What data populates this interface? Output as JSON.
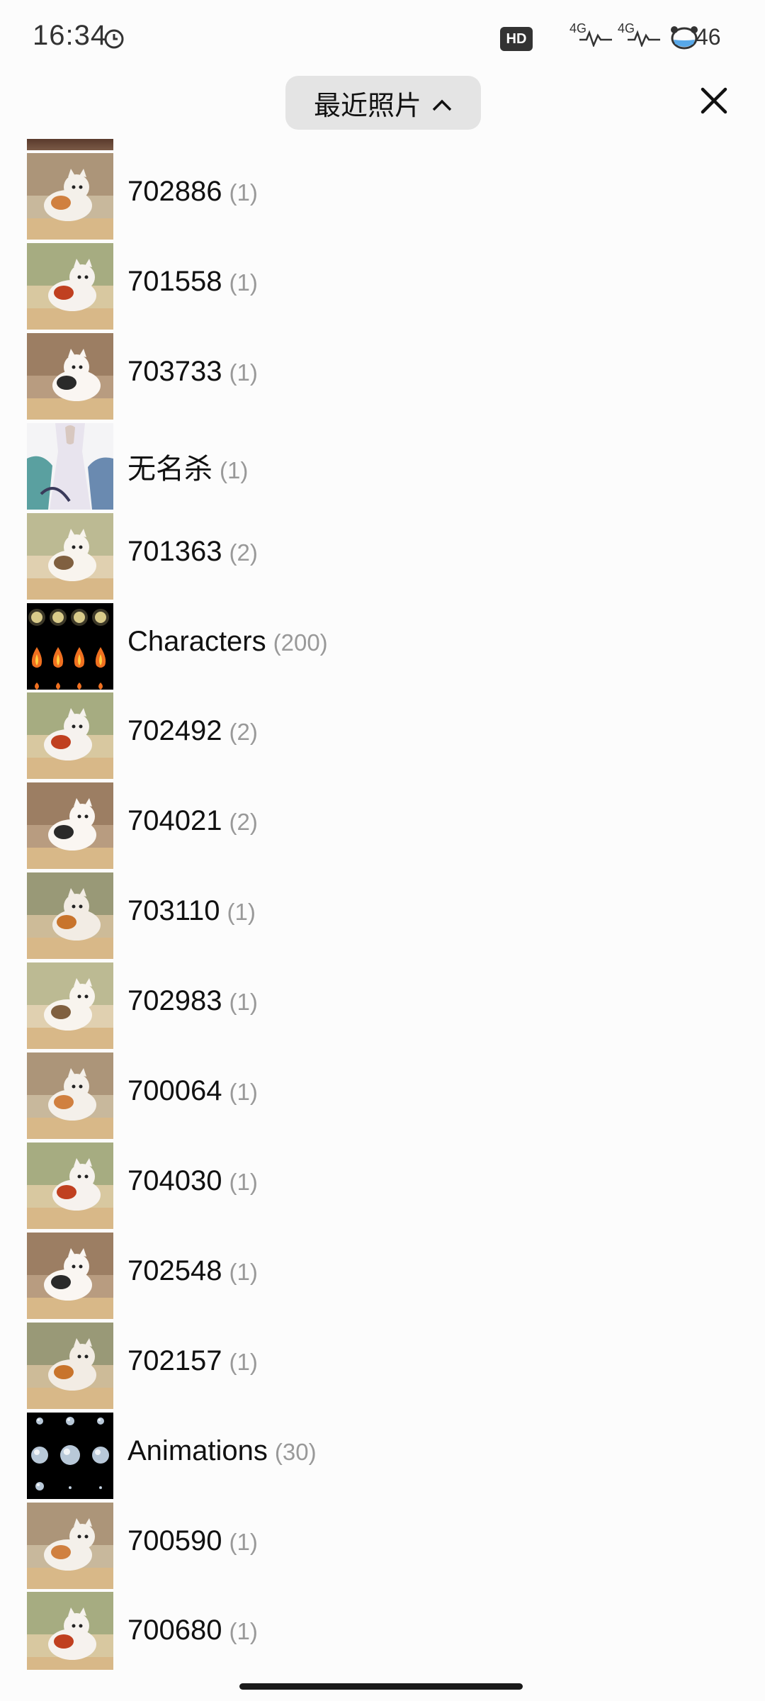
{
  "status_bar": {
    "time": "16:34",
    "hd_label": "HD",
    "net1": "4G",
    "net2": "4G",
    "battery": "46"
  },
  "header": {
    "album_picker_label": "最近照片",
    "close_icon": "close-icon",
    "chevron_icon": "chevron-up-icon"
  },
  "albums": [
    {
      "name": "702886",
      "count": "(1)",
      "thumb": "cat"
    },
    {
      "name": "701558",
      "count": "(1)",
      "thumb": "cat"
    },
    {
      "name": "703733",
      "count": "(1)",
      "thumb": "cat"
    },
    {
      "name": "无名杀",
      "count": "(1)",
      "thumb": "art"
    },
    {
      "name": "701363",
      "count": "(2)",
      "thumb": "cat"
    },
    {
      "name": "Characters",
      "count": "(200)",
      "thumb": "flames"
    },
    {
      "name": "702492",
      "count": "(2)",
      "thumb": "cat"
    },
    {
      "name": "704021",
      "count": "(2)",
      "thumb": "cat"
    },
    {
      "name": "703110",
      "count": "(1)",
      "thumb": "cat"
    },
    {
      "name": "702983",
      "count": "(1)",
      "thumb": "cat"
    },
    {
      "name": "700064",
      "count": "(1)",
      "thumb": "cat"
    },
    {
      "name": "704030",
      "count": "(1)",
      "thumb": "cat"
    },
    {
      "name": "702548",
      "count": "(1)",
      "thumb": "cat"
    },
    {
      "name": "702157",
      "count": "(1)",
      "thumb": "cat"
    },
    {
      "name": "Animations",
      "count": "(30)",
      "thumb": "orbs"
    },
    {
      "name": "700590",
      "count": "(1)",
      "thumb": "cat"
    },
    {
      "name": "700680",
      "count": "(1)",
      "thumb": "cat"
    }
  ]
}
